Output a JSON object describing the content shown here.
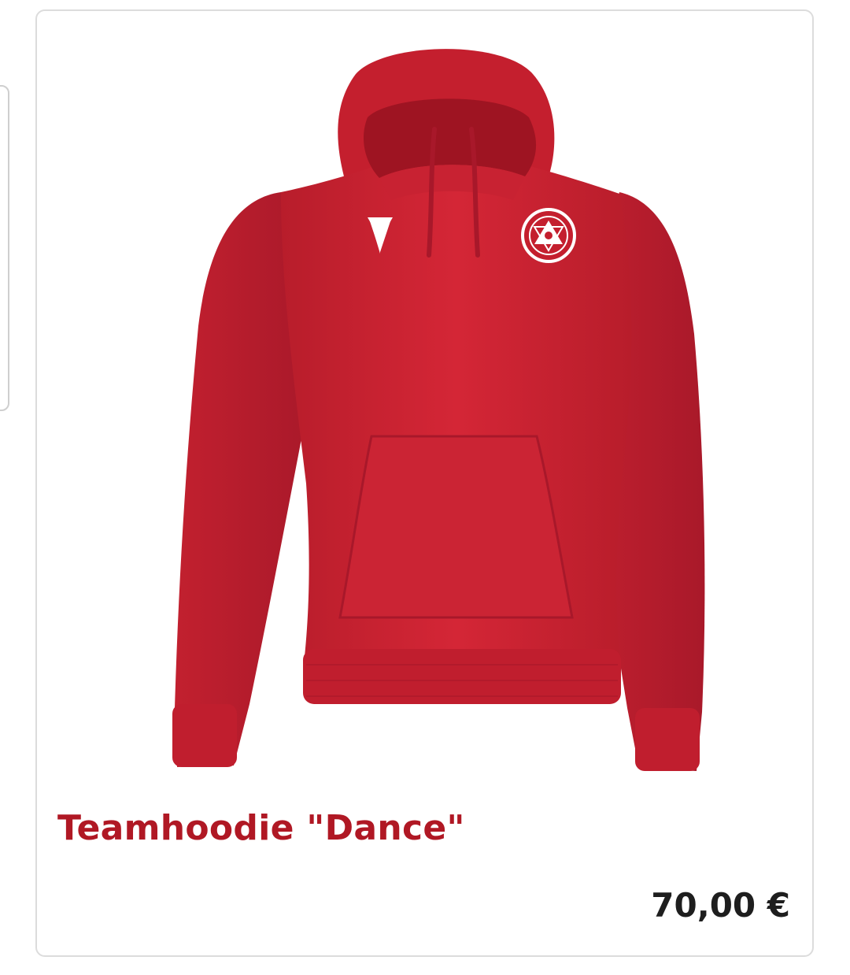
{
  "product": {
    "title": "Teamhoodie \"Dance\"",
    "price": "70,00 €",
    "image_alt": "red hooded sweatshirt",
    "brand_icon": "macron-logo-icon",
    "crest_icon": "club-crest-icon"
  },
  "colors": {
    "title": "#b01824",
    "price": "#1e1e1e",
    "hoodie": "#cf2332",
    "card_border": "#dcdcdc"
  }
}
